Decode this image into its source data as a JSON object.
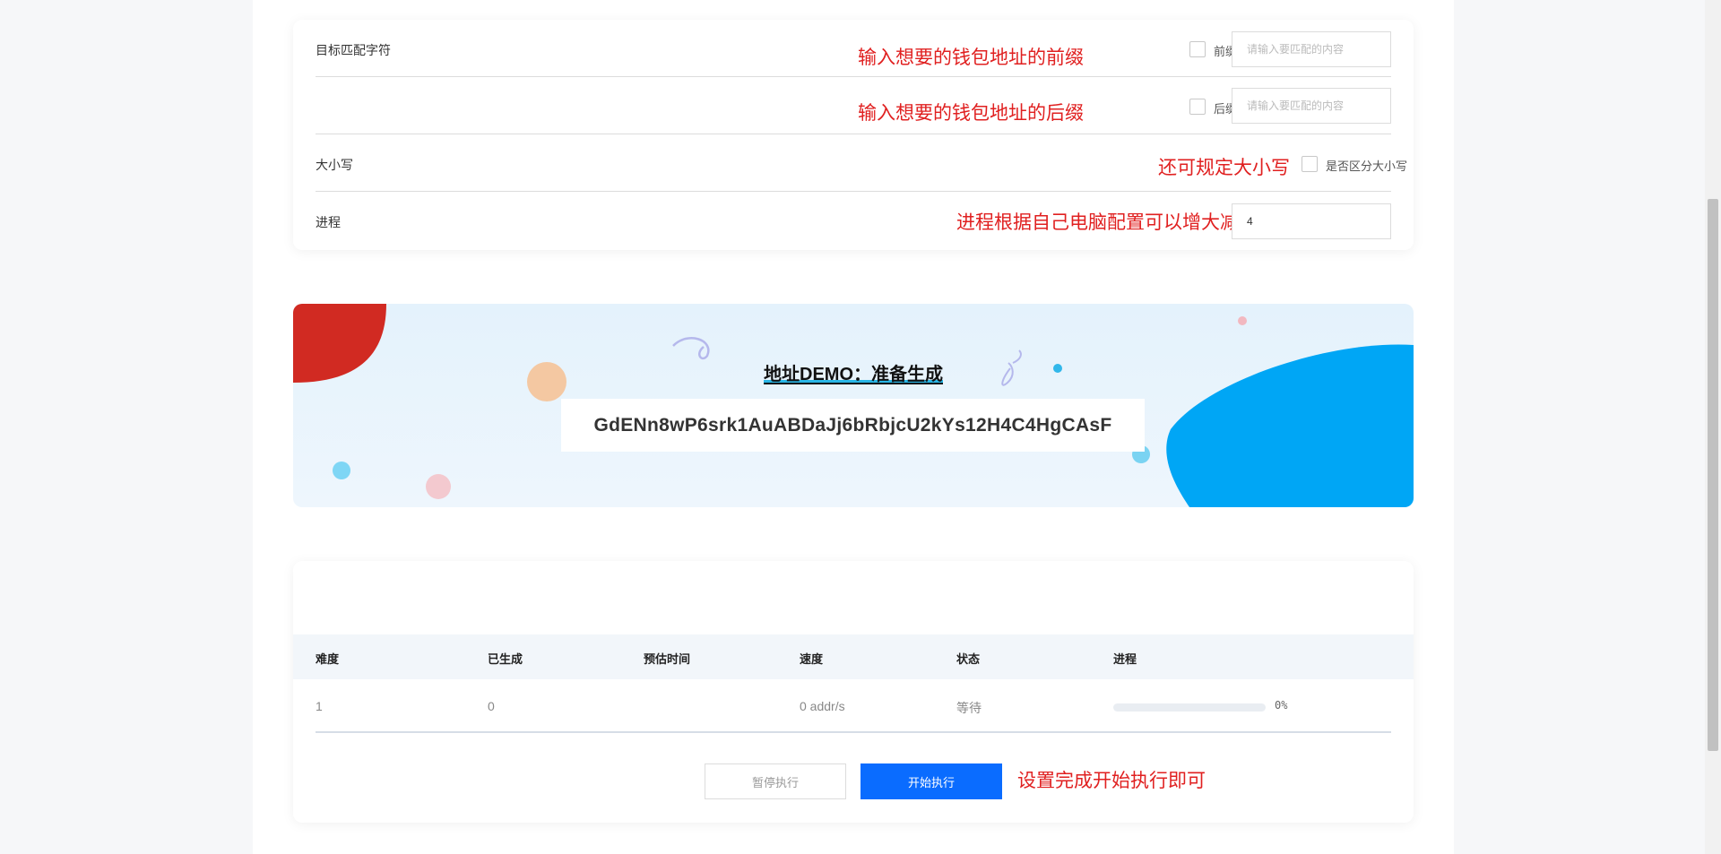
{
  "settings": {
    "match_label": "目标匹配字符",
    "prefix_note": "输入想要的钱包地址的前缀",
    "prefix_label": "前缀",
    "prefix_placeholder": "请输入要匹配的内容",
    "prefix_checked": false,
    "suffix_note": "输入想要的钱包地址的后缀",
    "suffix_label": "后缀",
    "suffix_placeholder": "请输入要匹配的内容",
    "suffix_checked": false,
    "case_label": "大小写",
    "case_note": "还可规定大小写",
    "case_checkbox_label": "是否区分大小写",
    "case_checked": false,
    "process_label": "进程",
    "process_note": "进程根据自己电脑配置可以增大减小",
    "process_value": "4"
  },
  "demo": {
    "title": "地址DEMO：准备生成",
    "address": "GdENn8wP6srk1AuABDaJj6bRbjcU2kYs12H4C4HgCAsF"
  },
  "table": {
    "headers": [
      "难度",
      "已生成",
      "预估时间",
      "速度",
      "状态",
      "进程"
    ],
    "row": {
      "difficulty": "1",
      "generated": "0",
      "estimate": "",
      "speed": "0 addr/s",
      "status": "等待",
      "progress_fraction": 0,
      "progress_text": "0%"
    }
  },
  "actions": {
    "pause_label": "暂停执行",
    "start_label": "开始执行",
    "start_note": "设置完成开始执行即可"
  },
  "colors": {
    "accent": "#0a6cff",
    "note_red": "#e02020",
    "demo_blue": "#00a6f5",
    "demo_red": "#d12a22"
  }
}
